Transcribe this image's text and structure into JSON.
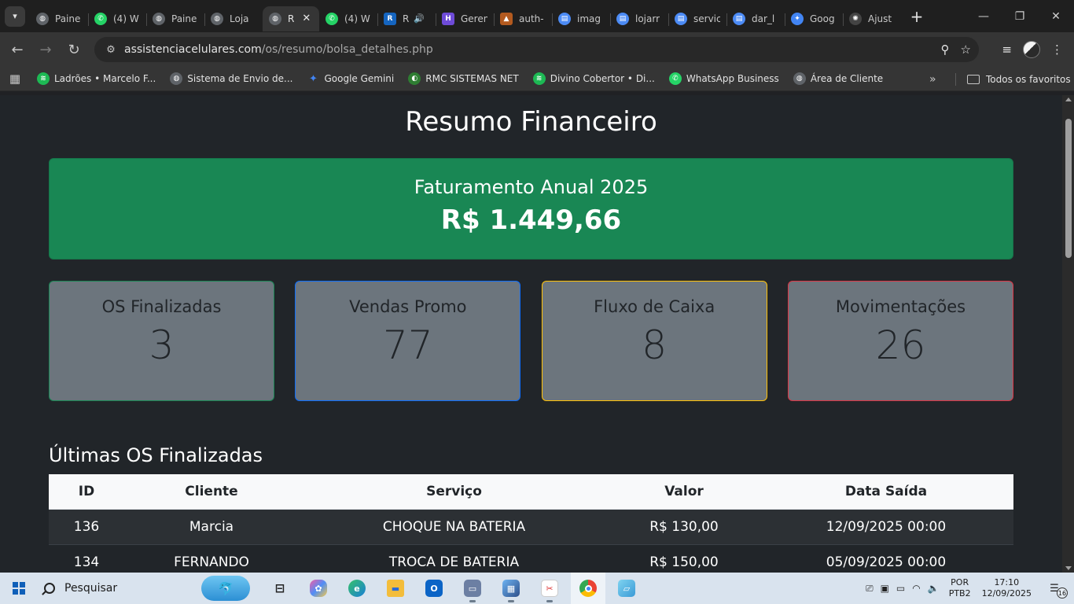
{
  "browser": {
    "tabs": [
      {
        "title": "Paine",
        "icon": "globe-icon",
        "color": "#5f6368"
      },
      {
        "title": "(4) W",
        "icon": "whatsapp-icon",
        "color": "#25d366"
      },
      {
        "title": "Paine",
        "icon": "globe-icon",
        "color": "#5f6368"
      },
      {
        "title": "Loja",
        "icon": "globe-icon",
        "color": "#5f6368"
      },
      {
        "title": "R",
        "icon": "globe-icon",
        "color": "#5f6368",
        "active": true
      },
      {
        "title": "(4) W",
        "icon": "whatsapp-icon",
        "color": "#25d366"
      },
      {
        "title": "R",
        "icon": "r-app-icon",
        "color": "#1565c0",
        "audio": true
      },
      {
        "title": "Geren",
        "icon": "manager-icon",
        "color": "#6e4bd8"
      },
      {
        "title": "auth-",
        "icon": "rust-icon",
        "color": "#b35a1f"
      },
      {
        "title": "imag",
        "icon": "document-icon",
        "color": "#4c8bf5"
      },
      {
        "title": "lojarr",
        "icon": "document-icon",
        "color": "#4c8bf5"
      },
      {
        "title": "servic",
        "icon": "document-icon",
        "color": "#4c8bf5"
      },
      {
        "title": "dar_l",
        "icon": "document-icon",
        "color": "#4c8bf5"
      },
      {
        "title": "Goog",
        "icon": "gemini-icon",
        "color": "#4285f4"
      },
      {
        "title": "Ajust",
        "icon": "openai-icon",
        "color": "#444444"
      }
    ],
    "url_host": "assistenciacelulares.com",
    "url_path": "/os/resumo/bolsa_detalhes.php",
    "bookmarks": [
      {
        "label": "Ladrões • Marcelo F...",
        "icon": "spotify-icon",
        "color": "#1db954"
      },
      {
        "label": "Sistema de Envio de...",
        "icon": "globe-icon",
        "color": "#5f6368"
      },
      {
        "label": "Google Gemini",
        "icon": "gemini-icon",
        "color": "#4285f4"
      },
      {
        "label": "RMC SISTEMAS NET",
        "icon": "rmc-icon",
        "color": "#2e7d32"
      },
      {
        "label": "Divino Cobertor • Di...",
        "icon": "spotify-icon",
        "color": "#1db954"
      },
      {
        "label": "WhatsApp Business",
        "icon": "whatsapp-icon",
        "color": "#25d366"
      },
      {
        "label": "Área de Cliente",
        "icon": "globe-icon",
        "color": "#5f6368"
      }
    ],
    "all_bookmarks_label": "Todos os favoritos"
  },
  "page": {
    "title": "Resumo Financeiro",
    "annual": {
      "label": "Faturamento Anual 2025",
      "value": "R$ 1.449,66"
    },
    "cards": [
      {
        "label": "OS Finalizadas",
        "value": "3",
        "border": "#198754"
      },
      {
        "label": "Vendas Promo",
        "value": "77",
        "border": "#0d6efd"
      },
      {
        "label": "Fluxo de Caixa",
        "value": "8",
        "border": "#ffc107"
      },
      {
        "label": "Movimentações",
        "value": "26",
        "border": "#dc3545"
      }
    ],
    "recent": {
      "title": "Últimas OS Finalizadas",
      "columns": [
        "ID",
        "Cliente",
        "Serviço",
        "Valor",
        "Data Saída"
      ],
      "rows": [
        [
          "136",
          "Marcia",
          "CHOQUE NA BATERIA",
          "R$ 130,00",
          "12/09/2025 00:00"
        ],
        [
          "134",
          "FERNANDO",
          "TROCA DE BATERIA",
          "R$ 150,00",
          "05/09/2025 00:00"
        ]
      ]
    }
  },
  "taskbar": {
    "search_placeholder": "Pesquisar",
    "lang_top": "POR",
    "lang_bottom": "PTB2",
    "time": "17:10",
    "date": "12/09/2025",
    "notifications": "16"
  }
}
